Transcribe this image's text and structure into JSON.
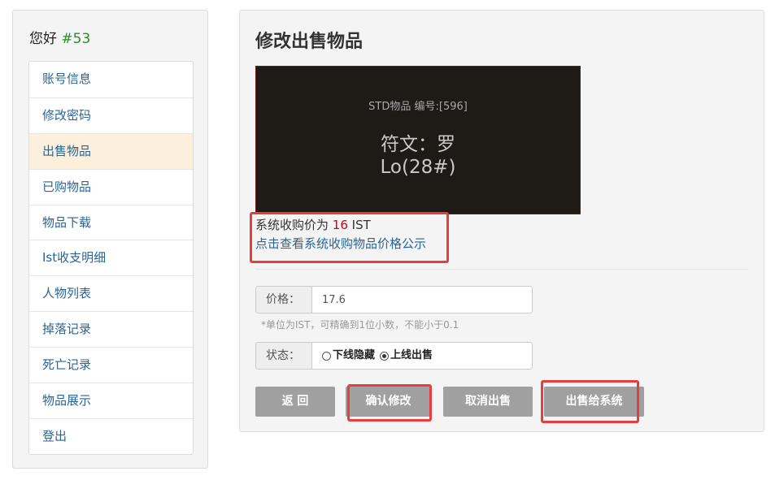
{
  "sidebar": {
    "greeting": "您好",
    "user_id": "#53",
    "items": [
      {
        "label": "账号信息"
      },
      {
        "label": "修改密码"
      },
      {
        "label": "出售物品"
      },
      {
        "label": "已购物品"
      },
      {
        "label": "物品下载"
      },
      {
        "label": "Ist收支明细"
      },
      {
        "label": "人物列表"
      },
      {
        "label": "掉落记录"
      },
      {
        "label": "死亡记录"
      },
      {
        "label": "物品展示"
      },
      {
        "label": "登出"
      }
    ]
  },
  "main": {
    "title": "修改出售物品",
    "item": {
      "meta": "STD物品 编号:[596]",
      "name": "符文：罗",
      "code": "Lo(28#)"
    },
    "system_price_prefix": "系统收购价为",
    "system_price_value": "16",
    "system_price_unit": "IST",
    "system_price_link": "点击查看系统收购物品价格公示",
    "price_label": "价格：",
    "price_value": "17.6",
    "price_hint": "*单位为IST，可精确到1位小数，不能小于0.1",
    "status_label": "状态：",
    "status_options": [
      {
        "label": "下线隐藏",
        "checked": false
      },
      {
        "label": "上线出售",
        "checked": true
      }
    ],
    "buttons": {
      "back": "返 回",
      "confirm": "确认修改",
      "cancel_sale": "取消出售",
      "sell_to_system": "出售给系统"
    }
  },
  "colors": {
    "link": "#2a6496",
    "price_highlight": "#d0021b",
    "user_id": "#2e8b2e",
    "active_menu_bg": "#fcefdc",
    "button_bg": "#a0a0a0",
    "annotation_border": "#e53e3e",
    "item_card_bg": "#1e1a16"
  }
}
